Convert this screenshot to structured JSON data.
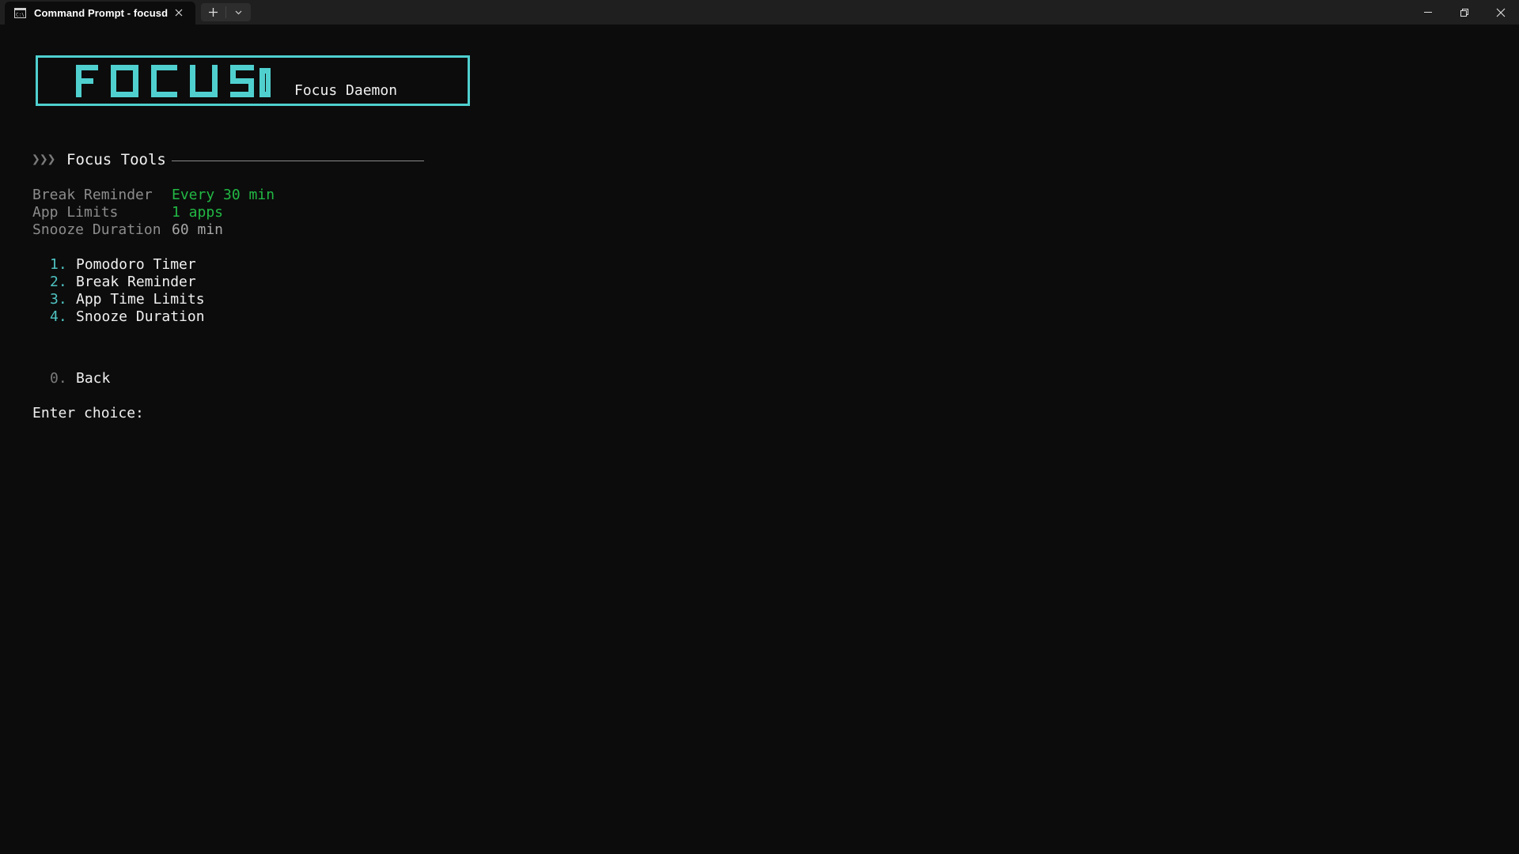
{
  "window": {
    "tab_title": "Command Prompt - focusd",
    "tab_icon": "terminal-icon",
    "new_tab_icon": "plus-icon",
    "dropdown_icon": "chevron-down-icon",
    "minimize_icon": "minimize-icon",
    "maximize_icon": "restore-icon",
    "close_icon": "close-icon"
  },
  "banner": {
    "logo_text": "FOCUSD",
    "subtitle": "Focus Daemon",
    "accent_color": "#4fd0cf"
  },
  "section": {
    "prefix": "❯❯❯",
    "title": "Focus Tools"
  },
  "status": [
    {
      "label": "Break Reminder",
      "value": "Every 30 min",
      "color": "#22b844"
    },
    {
      "label": "App Limits",
      "value": "1 apps",
      "color": "#22b844"
    },
    {
      "label": "Snooze Duration",
      "value": "60 min",
      "color": "#a6a6a6"
    }
  ],
  "menu": [
    {
      "number": "1.",
      "label": "Pomodoro Timer"
    },
    {
      "number": "2.",
      "label": "Break Reminder"
    },
    {
      "number": "3.",
      "label": "App Time Limits"
    },
    {
      "number": "4.",
      "label": "Snooze Duration"
    }
  ],
  "back": {
    "number": "0.",
    "label": "Back"
  },
  "prompt": "Enter choice:"
}
